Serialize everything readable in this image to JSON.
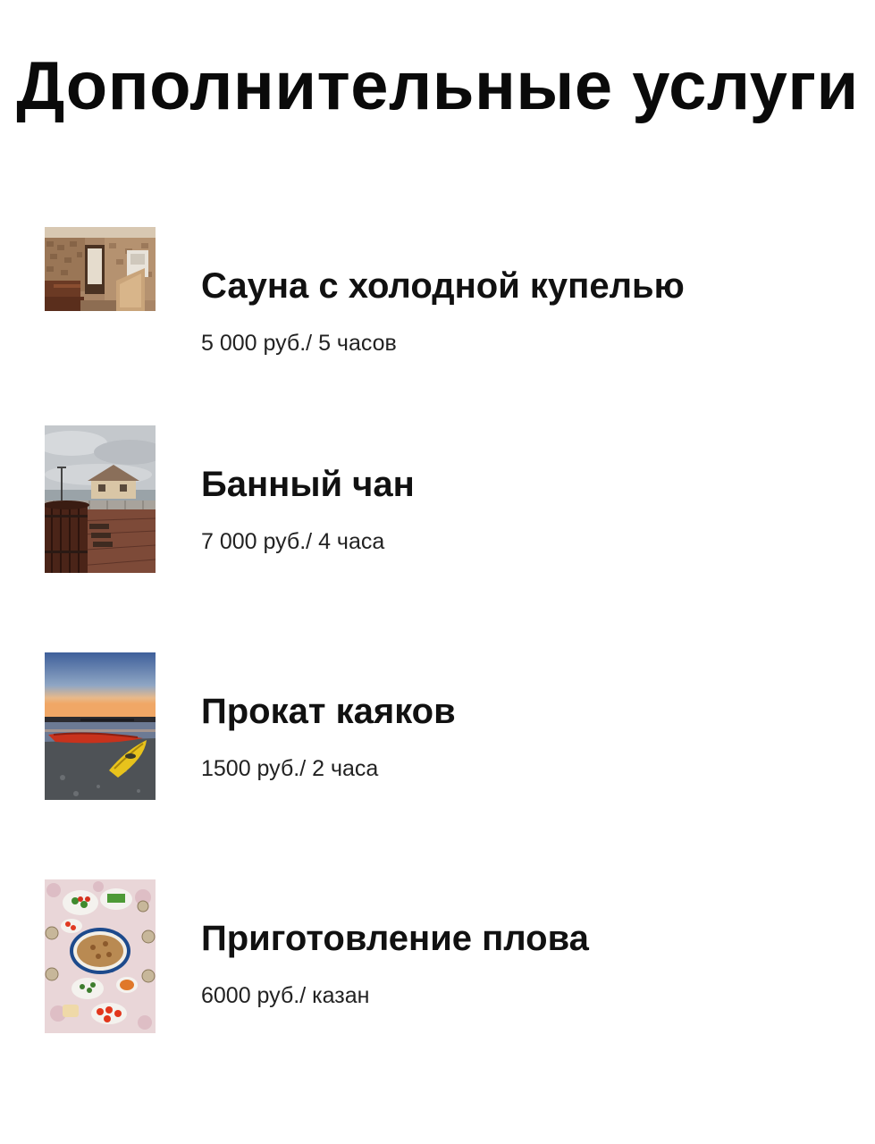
{
  "header": {
    "title": "Дополнительные услуги"
  },
  "services": [
    {
      "name": "Сауна с холодной купелью",
      "price": "5 000 руб./ 5 часов",
      "image": "sauna-photo"
    },
    {
      "name": "Банный чан",
      "price": "7 000 руб./ 4 часа",
      "image": "hot-tub-photo"
    },
    {
      "name": "Прокат каяков",
      "price": "1500 руб./ 2 часа",
      "image": "kayaks-photo"
    },
    {
      "name": "Приготовление плова",
      "price": "6000 руб./ казан",
      "image": "pilaf-table-photo"
    }
  ]
}
